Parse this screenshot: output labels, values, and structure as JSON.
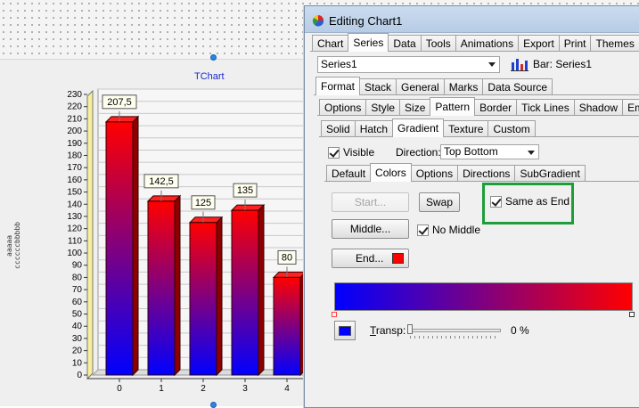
{
  "chart": {
    "title": "TChart",
    "side_label": [
      "aaaaa",
      "ccccccbbbbb"
    ],
    "chart_data": {
      "type": "bar",
      "categories": [
        "0",
        "1",
        "2",
        "3",
        "4"
      ],
      "values": [
        207.5,
        142.5,
        125,
        135,
        80
      ],
      "labels": [
        "207,5",
        "142,5",
        "125",
        "135",
        "80"
      ],
      "ylim": [
        0,
        230
      ],
      "yticks": [
        "0",
        "10",
        "20",
        "30",
        "40",
        "50",
        "60",
        "70",
        "80",
        "90",
        "100",
        "110",
        "120",
        "130",
        "140",
        "150",
        "160",
        "170",
        "180",
        "190",
        "200",
        "210",
        "220",
        "230"
      ],
      "gradient": {
        "top": "#ff0000",
        "bottom": "#0000ff"
      },
      "grid": true
    }
  },
  "dialog": {
    "title": "Editing Chart1",
    "main_tabs": [
      "Chart",
      "Series",
      "Data",
      "Tools",
      "Animations",
      "Export",
      "Print",
      "Themes"
    ],
    "main_active": "Series",
    "series_select": "Series1",
    "series_info": "Bar: Series1",
    "series_tabs": [
      "Format",
      "Stack",
      "General",
      "Marks",
      "Data Source"
    ],
    "series_active": "Format",
    "format_tabs": [
      "Options",
      "Style",
      "Size",
      "Pattern",
      "Border",
      "Tick Lines",
      "Shadow",
      "Embo"
    ],
    "format_active": "Pattern",
    "pattern_tabs": [
      "Solid",
      "Hatch",
      "Gradient",
      "Texture",
      "Custom"
    ],
    "pattern_active": "Gradient",
    "visible_label": "Visible",
    "direction_label": "Direction:",
    "direction_value": "Top Bottom",
    "gradient_tabs": [
      "Default",
      "Colors",
      "Options",
      "Directions",
      "SubGradient"
    ],
    "gradient_active": "Colors",
    "start_button": "Start...",
    "swap_button": "Swap",
    "same_as_end_label": "Same as End",
    "middle_button": "Middle...",
    "no_middle_label": "No Middle",
    "end_button": "End...",
    "end_color": "#ff0000",
    "transp_label": "Transp:",
    "transp_value": "0 %",
    "gradient_colors": {
      "start": "#0000ff",
      "end": "#ff0000"
    },
    "transparency_level": 0
  }
}
